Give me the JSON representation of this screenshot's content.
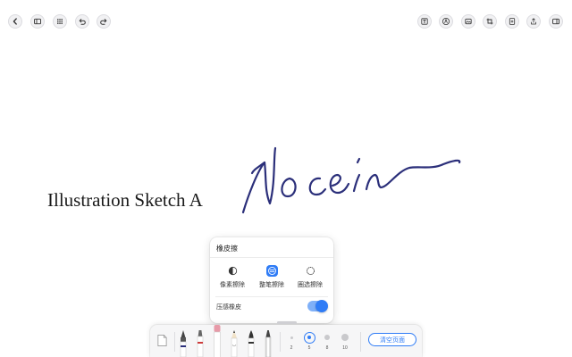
{
  "topbar": {
    "left_icons": [
      "back-icon",
      "sidebar-icon",
      "grid-icon",
      "undo-icon",
      "redo-icon"
    ],
    "right_icons": [
      "text-icon",
      "pen-mode-icon",
      "image-icon",
      "crop-icon",
      "add-page-icon",
      "share-icon",
      "panel-icon"
    ]
  },
  "canvas": {
    "label": "Illustration Sketch A",
    "signature_color": "#2b2f7a"
  },
  "eraser_panel": {
    "title": "橡皮擦",
    "options": [
      {
        "label": "像素擦除",
        "icon": "pixel-erase-icon",
        "selected": false
      },
      {
        "label": "整笔擦除",
        "icon": "stroke-erase-icon",
        "selected": true
      },
      {
        "label": "圈选擦除",
        "icon": "lasso-erase-icon",
        "selected": false
      }
    ],
    "pressure_label": "压感橡皮",
    "pressure_enabled": true
  },
  "toolbar": {
    "tools": [
      "page-template-icon",
      "fountain-pen-icon",
      "marker-icon",
      "eraser-icon",
      "pencil-icon",
      "brush-pen-icon",
      "calligraphy-pen-icon"
    ],
    "sizes": [
      {
        "num": "2",
        "selected": false
      },
      {
        "num": "5",
        "selected": true
      },
      {
        "num": "8",
        "selected": false
      },
      {
        "num": "10",
        "selected": false
      }
    ],
    "clear_label": "清空页面"
  },
  "colors": {
    "accent": "#2f7cf6",
    "ink": "#2b2f7a"
  }
}
